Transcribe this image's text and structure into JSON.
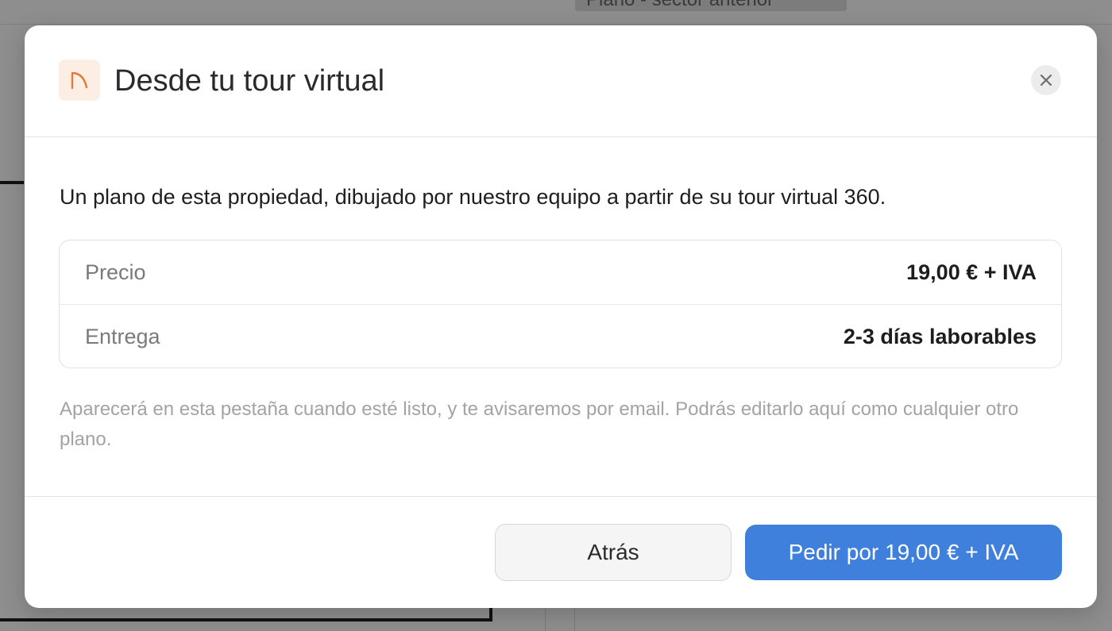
{
  "background": {
    "chip_text": "Plano - sector anterior"
  },
  "modal": {
    "title": "Desde tu tour virtual",
    "icon": "floor-plan-arc-icon",
    "close_icon": "close-icon",
    "description": "Un plano de esta propiedad, dibujado por nuestro equipo a partir de su tour virtual 360.",
    "details": [
      {
        "label": "Precio",
        "value": "19,00 € + IVA"
      },
      {
        "label": "Entrega",
        "value": "2-3 días laborables"
      }
    ],
    "note": "Aparecerá en esta pestaña cuando esté listo, y te avisaremos por email. Podrás editarlo aquí como cualquier otro plano.",
    "buttons": {
      "back": "Atrás",
      "order": "Pedir por 19,00 € + IVA"
    }
  },
  "colors": {
    "accent": "#3f80dc",
    "icon_tint": "#e07a3a",
    "icon_bg": "#fdeee3"
  }
}
